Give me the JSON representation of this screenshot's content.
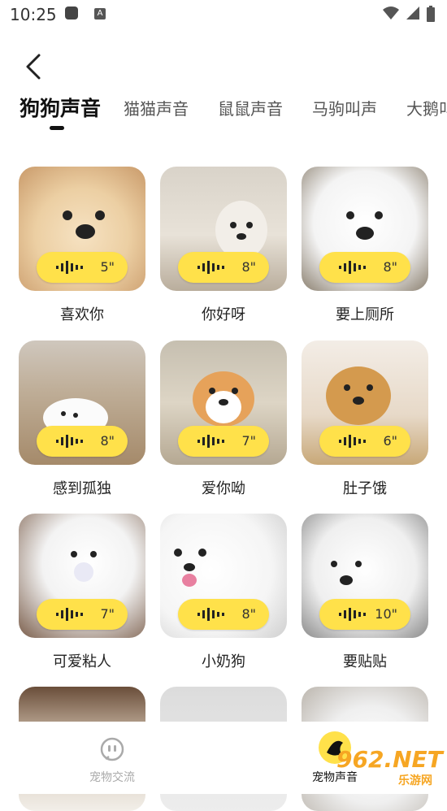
{
  "status": {
    "time": "10:25",
    "indicator": "A"
  },
  "tabs": [
    {
      "label": "狗狗声音"
    },
    {
      "label": "猫猫声音"
    },
    {
      "label": "鼠鼠声音"
    },
    {
      "label": "马驹叫声"
    },
    {
      "label": "大鹅叫"
    }
  ],
  "sounds": [
    {
      "label": "喜欢你",
      "duration": "5\""
    },
    {
      "label": "你好呀",
      "duration": "8\""
    },
    {
      "label": "要上厕所",
      "duration": "8\""
    },
    {
      "label": "感到孤独",
      "duration": "8\""
    },
    {
      "label": "爱你呦",
      "duration": "7\""
    },
    {
      "label": "肚子饿",
      "duration": "6\""
    },
    {
      "label": "可爱粘人",
      "duration": "7\""
    },
    {
      "label": "小奶狗",
      "duration": "8\""
    },
    {
      "label": "要贴贴",
      "duration": "10\""
    }
  ],
  "bottom_nav": [
    {
      "label": "宠物交流"
    },
    {
      "label": "宠物声音"
    }
  ],
  "watermark": {
    "main": "962.NET",
    "sub": "乐游网"
  },
  "colors": {
    "accent": "#ffe14a",
    "inactive": "#aaaaaa"
  }
}
